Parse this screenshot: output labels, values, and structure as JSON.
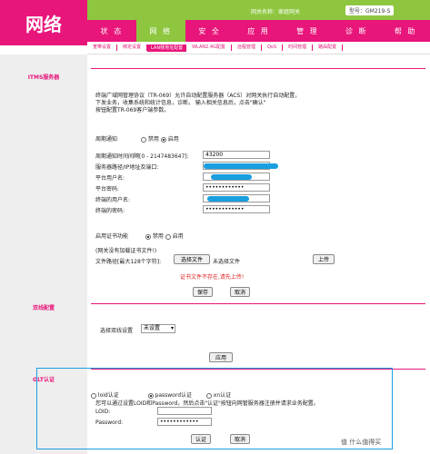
{
  "logo": "网络",
  "gateway_name": "网关名称：家庭网关",
  "model": "型号：GM219-S",
  "main_nav": [
    "状 态",
    "网 络",
    "安 全",
    "应 用",
    "管 理",
    "诊 断",
    "帮 助"
  ],
  "sub_nav": [
    "宽带设置",
    "绑定设置",
    "LAN侧地址配置",
    "WLAN2.4G配置",
    "远程管理",
    "QoS",
    "时间管理",
    "路由配置"
  ],
  "sidebar": {
    "itms": "ITMS服务器",
    "binding": "双线配置",
    "olt": "OLT认证"
  },
  "itms": {
    "desc1": "终端广域网管理协议（TR-069）允许自动配置服务器（ACS）对网关执行自动配置，",
    "desc2": "下发业务，收集系统和统计信息，诊断。 输入相关信息后，点击\"确认\"",
    "desc3": "按钮配置TR-069客户端参数。",
    "periodic_label": "周期通知",
    "disable": "禁用",
    "enable": "启用",
    "interval_label": "周期通知时间间隔[0 - 2147483647]:",
    "interval_value": "43200",
    "acs_url_label": "服务器路径/IP地址及端口:",
    "platform_user_label": "平台用户名:",
    "platform_pwd_label": "平台密码:",
    "platform_pwd_value": "••••••••••••",
    "terminal_user_label": "终端的用户名:",
    "terminal_pwd_label": "终端的密码:",
    "terminal_pwd_value": "••••••••••••",
    "cert_label": "启用证书功能",
    "cert_note": "(网关没有加载证书文件!)",
    "file_path_label": "文件路径[最大128个字符]:",
    "choose_file": "选择文件",
    "no_file": "未选择文件",
    "upload": "上传",
    "cert_error": "证书文件不存在,请先上传!",
    "save": "保存",
    "cancel": "取消"
  },
  "binding": {
    "select_label": "选择双线设置",
    "select_value": "未设置",
    "apply": "应用"
  },
  "olt": {
    "opt_loid": "loid认证",
    "opt_password": "password认证",
    "opt_xn": "xn认证",
    "desc": "您可以通过设置LOID和Password，然后点击\"认证\"按钮向网管服务器注册并请求业务配置。",
    "loid_label": "LOID:",
    "password_label": "Password:",
    "password_value": "••••••••••••",
    "auth": "认证",
    "cancel": "取消"
  },
  "watermark": "值 什么值得买"
}
